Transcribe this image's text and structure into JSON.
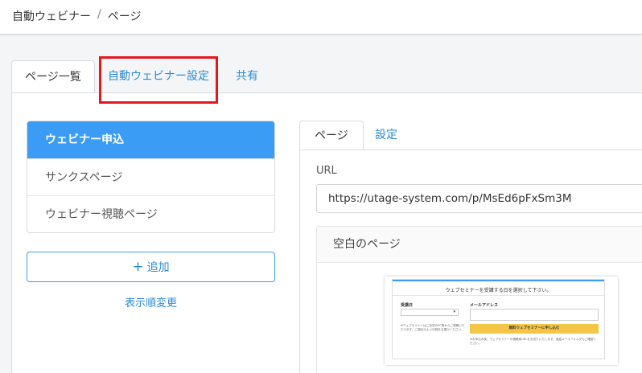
{
  "breadcrumb": {
    "root": "自動ウェビナー",
    "separator": "/",
    "current": "ページ"
  },
  "tabs": [
    {
      "label": "ページ一覧",
      "active": true
    },
    {
      "label": "自動ウェビナー設定",
      "active": false
    },
    {
      "label": "共有",
      "active": false
    }
  ],
  "pages_list": {
    "items": [
      {
        "label": "ウェビナー申込",
        "active": true
      },
      {
        "label": "サンクスページ",
        "active": false
      },
      {
        "label": "ウェビナー視聴ページ",
        "active": false
      }
    ],
    "add_icon": "plus-icon",
    "add_label": "追加",
    "sort_label": "表示順変更"
  },
  "subtabs": [
    {
      "label": "ページ",
      "active": true
    },
    {
      "label": "設定",
      "active": false
    }
  ],
  "url": {
    "label": "URL",
    "value": "https://utage-system.com/p/MsEd6pFxSm3M"
  },
  "preview": {
    "title": "空白のページ",
    "thumb": {
      "heading": "ウェブセミナーを受講する日を選択して下さい。",
      "date_label": "受講日",
      "email_label": "メールアドレス",
      "button_label": "無料ウェブセミナーに申し込む",
      "note_left": "※ウェブセミナーはご自宅のPC等からご視聴いただけます。ご都合のよい日程をお選びください。",
      "note_right": "※お申込み後、ウェブセミナーの視聴用URLをお送りいたします。迷惑メールフォルダもご確認ください。"
    }
  },
  "colors": {
    "accent": "#3b9cf5",
    "link": "#2a8bd8",
    "highlight": "#e3171c",
    "cta": "#f5c645"
  }
}
